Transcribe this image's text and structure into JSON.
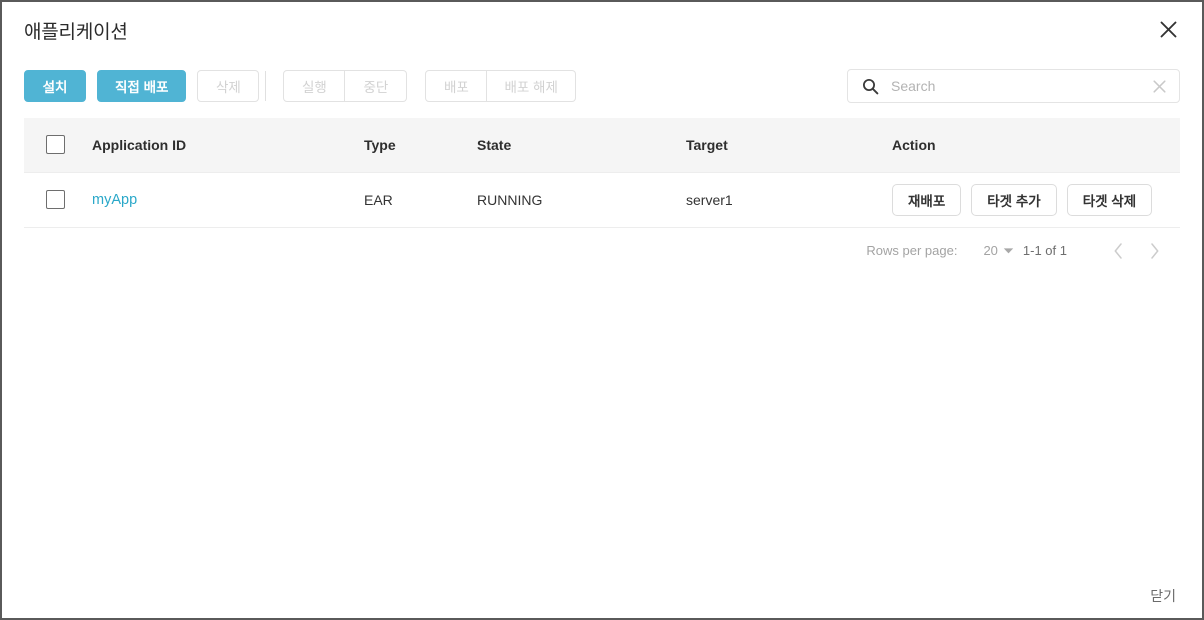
{
  "dialog": {
    "title": "애플리케이션",
    "close_icon": "close-x-icon"
  },
  "toolbar": {
    "install_label": "설치",
    "direct_deploy_label": "직접 배포",
    "delete_label": "삭제",
    "start_label": "실행",
    "stop_label": "중단",
    "deploy_label": "배포",
    "undeploy_label": "배포 해제",
    "primary_color": "#50b4d4",
    "disabled_color": "#d2d2d2"
  },
  "search": {
    "placeholder": "Search",
    "value": "",
    "search_icon": "search-icon",
    "clear_icon": "clear-x-icon"
  },
  "table": {
    "columns": [
      {
        "key": "checkbox",
        "label": ""
      },
      {
        "key": "appid",
        "label": "Application ID"
      },
      {
        "key": "type",
        "label": "Type"
      },
      {
        "key": "state",
        "label": "State"
      },
      {
        "key": "target",
        "label": "Target"
      },
      {
        "key": "action",
        "label": "Action"
      }
    ],
    "rows": [
      {
        "checked": false,
        "appid": "myApp",
        "appid_color": "#2aa8c9",
        "type": "EAR",
        "state": "RUNNING",
        "target": "server1",
        "actions": [
          "재배포",
          "타겟 추가",
          "타겟 삭제"
        ]
      }
    ]
  },
  "pagination": {
    "rows_per_page_label": "Rows per page:",
    "rows_per_page_value": "20",
    "range_label": "1-1 of 1",
    "prev_icon": "chevron-left-icon",
    "next_icon": "chevron-right-icon",
    "caret_icon": "caret-down-icon"
  },
  "footer": {
    "close_label": "닫기"
  }
}
